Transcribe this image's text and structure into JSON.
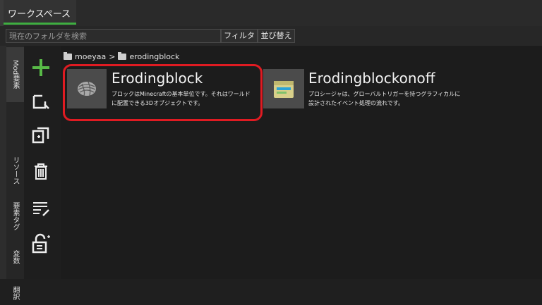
{
  "tabs": {
    "workspace": "ワークスペース"
  },
  "search": {
    "placeholder": "現在のフォルダを検索",
    "value": ""
  },
  "toolbar": {
    "filter_label": "フィルタ",
    "sort_label": "並び替え"
  },
  "side_tabs": [
    {
      "label": "Mod要素",
      "active": true
    },
    {
      "label": "リソース",
      "active": false
    },
    {
      "label": "要素タグ",
      "active": false
    },
    {
      "label": "変数",
      "active": false
    },
    {
      "label": "翻訳",
      "active": false
    }
  ],
  "actions": [
    {
      "icon": "plus-icon",
      "color": "#58b947"
    },
    {
      "icon": "edit-icon"
    },
    {
      "icon": "duplicate-icon"
    },
    {
      "icon": "trash-icon"
    },
    {
      "icon": "list-edit-icon"
    },
    {
      "icon": "lock-icon"
    }
  ],
  "breadcrumb": {
    "root": "moeyaa",
    "separator": ">",
    "current": "erodingblock"
  },
  "items": [
    {
      "name": "Erodingblock",
      "description": "ブロックはMinecraftの基本単位です。それはワールド\nに配置できる3Dオブジェクトです。",
      "icon": "block-icon",
      "highlighted": true
    },
    {
      "name": "Erodingblockonoff",
      "description": "プロシージャは、グローバルトリガーを持つグラフィカルに\n設計されたイベント処理の流れです。",
      "icon": "procedure-icon",
      "highlighted": false
    }
  ],
  "colors": {
    "accent": "#3fae41",
    "highlight": "#e01b22",
    "background": "#1c1c1c"
  }
}
